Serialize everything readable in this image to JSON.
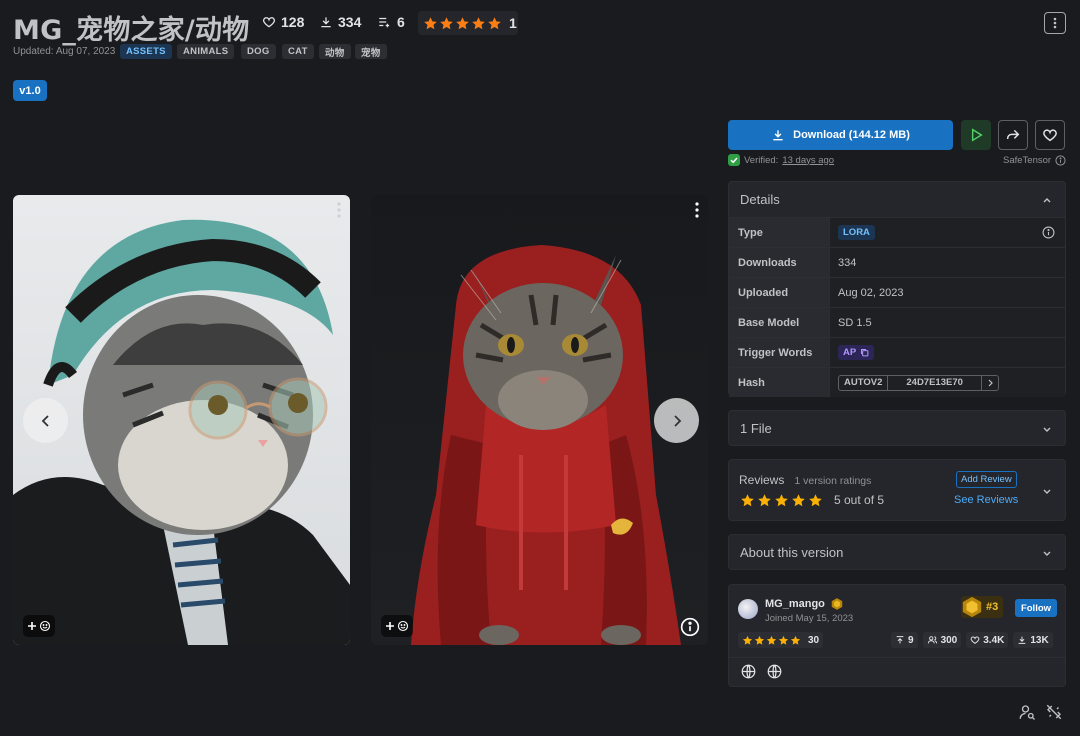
{
  "header": {
    "title": "MG_宠物之家/动物",
    "likes": "128",
    "downloads": "334",
    "collections": "6",
    "rating_count": "1",
    "updated": "Updated: Aug 07, 2023",
    "tags": [
      "ASSETS",
      "ANIMALS",
      "DOG",
      "CAT",
      "动物",
      "宠物"
    ],
    "version": "v1.0"
  },
  "actions": {
    "download_label": "Download (144.12 MB)",
    "verified_prefix": "Verified:",
    "verified_when": "13 days ago",
    "safetensor": "SafeTensor"
  },
  "details": {
    "title": "Details",
    "rows": [
      {
        "label": "Type",
        "value": "LORA"
      },
      {
        "label": "Downloads",
        "value": "334"
      },
      {
        "label": "Uploaded",
        "value": "Aug 02, 2023"
      },
      {
        "label": "Base Model",
        "value": "SD 1.5"
      },
      {
        "label": "Trigger Words",
        "value": "AP"
      },
      {
        "label": "Hash",
        "value": "24D7E13E70",
        "hash_type": "AUTOV2"
      }
    ]
  },
  "files": {
    "title": "1 File"
  },
  "reviews": {
    "title": "Reviews",
    "subtitle": "1 version ratings",
    "add_review": "Add Review",
    "summary": "5 out of 5",
    "see_reviews": "See Reviews"
  },
  "about": {
    "title": "About this version"
  },
  "creator": {
    "name": "MG_mango",
    "joined": "Joined May 15, 2023",
    "rank": "#3",
    "follow": "Follow",
    "rating_count": "30",
    "uploads": "9",
    "followers": "300",
    "likes": "3.4K",
    "downloads": "13K"
  },
  "colors": {
    "accent": "#1971c2",
    "star": "#fab005"
  },
  "icons": [
    "heart-icon",
    "download-icon",
    "playlist-add-icon",
    "star-icon",
    "dots-vertical-icon",
    "play-icon",
    "share-icon",
    "info-icon",
    "chevron-up-icon",
    "chevron-down-icon",
    "chevron-left-icon",
    "chevron-right-icon",
    "copy-icon",
    "globe-icon",
    "plus-icon",
    "smile-icon"
  ]
}
